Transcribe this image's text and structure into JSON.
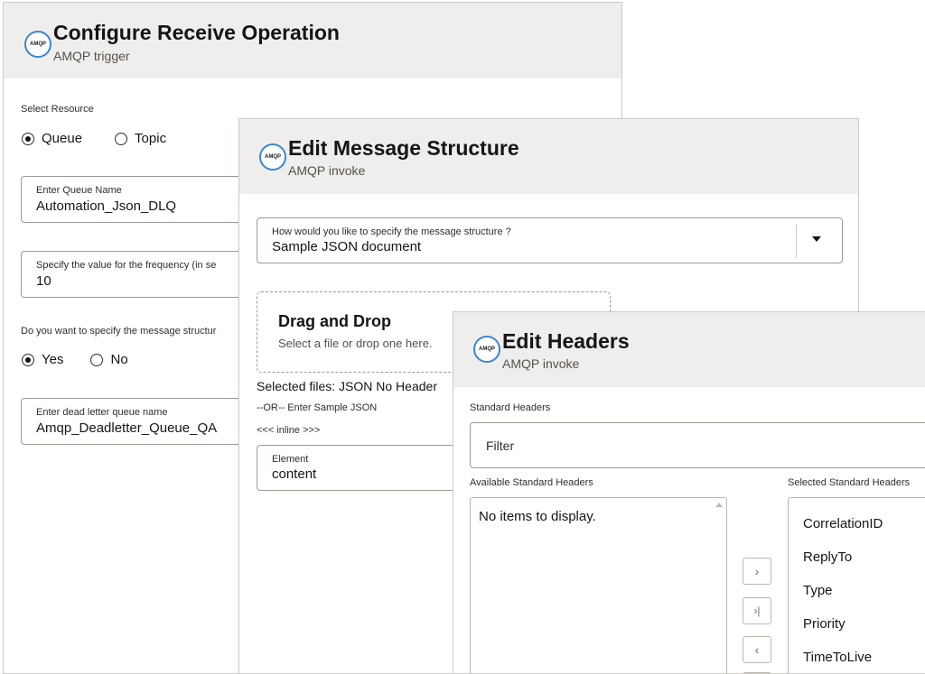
{
  "colors": {
    "header_bg": "#f0eeec",
    "logo_ring": "#3a86d6",
    "border": "#cfcac4"
  },
  "receive": {
    "logo_text": "AMQP",
    "title": "Configure Receive Operation",
    "subtitle": "AMQP trigger",
    "select_resource_label": "Select Resource",
    "resource_options": [
      "Queue",
      "Topic"
    ],
    "resource_selected": "Queue",
    "queue_name_label": "Enter Queue Name",
    "queue_name_value": "Automation_Json_DLQ",
    "frequency_label": "Specify the value for the frequency (in se",
    "frequency_value": "10",
    "structure_question": "Do you want to specify the message structur",
    "structure_options": [
      "Yes",
      "No"
    ],
    "structure_selected": "Yes",
    "dlq_label": "Enter dead letter queue name",
    "dlq_value": "Amqp_Deadletter_Queue_QA"
  },
  "message": {
    "logo_text": "AMQP",
    "title": "Edit Message Structure",
    "subtitle": "AMQP invoke",
    "select_label": "How would you like to specify the message structure ?",
    "select_value": "Sample JSON document",
    "dropzone_title": "Drag and Drop",
    "dropzone_hint": "Select a file or drop one here.",
    "selected_files": "Selected files: JSON No Header",
    "or_text": "--OR-- Enter Sample JSON",
    "inline_text": "<<< inline >>>",
    "element_label": "Element",
    "element_value": "content"
  },
  "headers": {
    "logo_text": "AMQP",
    "title": "Edit Headers",
    "subtitle": "AMQP invoke",
    "standard_headers_label": "Standard Headers",
    "filter_placeholder": "Filter",
    "available_label": "Available Standard Headers",
    "available_empty": "No items to display.",
    "selected_label": "Selected Standard Headers",
    "selected_items": [
      "CorrelationID",
      "ReplyTo",
      "Type",
      "Priority",
      "TimeToLive"
    ],
    "shuttle_icons": [
      "move-right-icon",
      "move-all-right-icon",
      "move-left-icon"
    ]
  }
}
